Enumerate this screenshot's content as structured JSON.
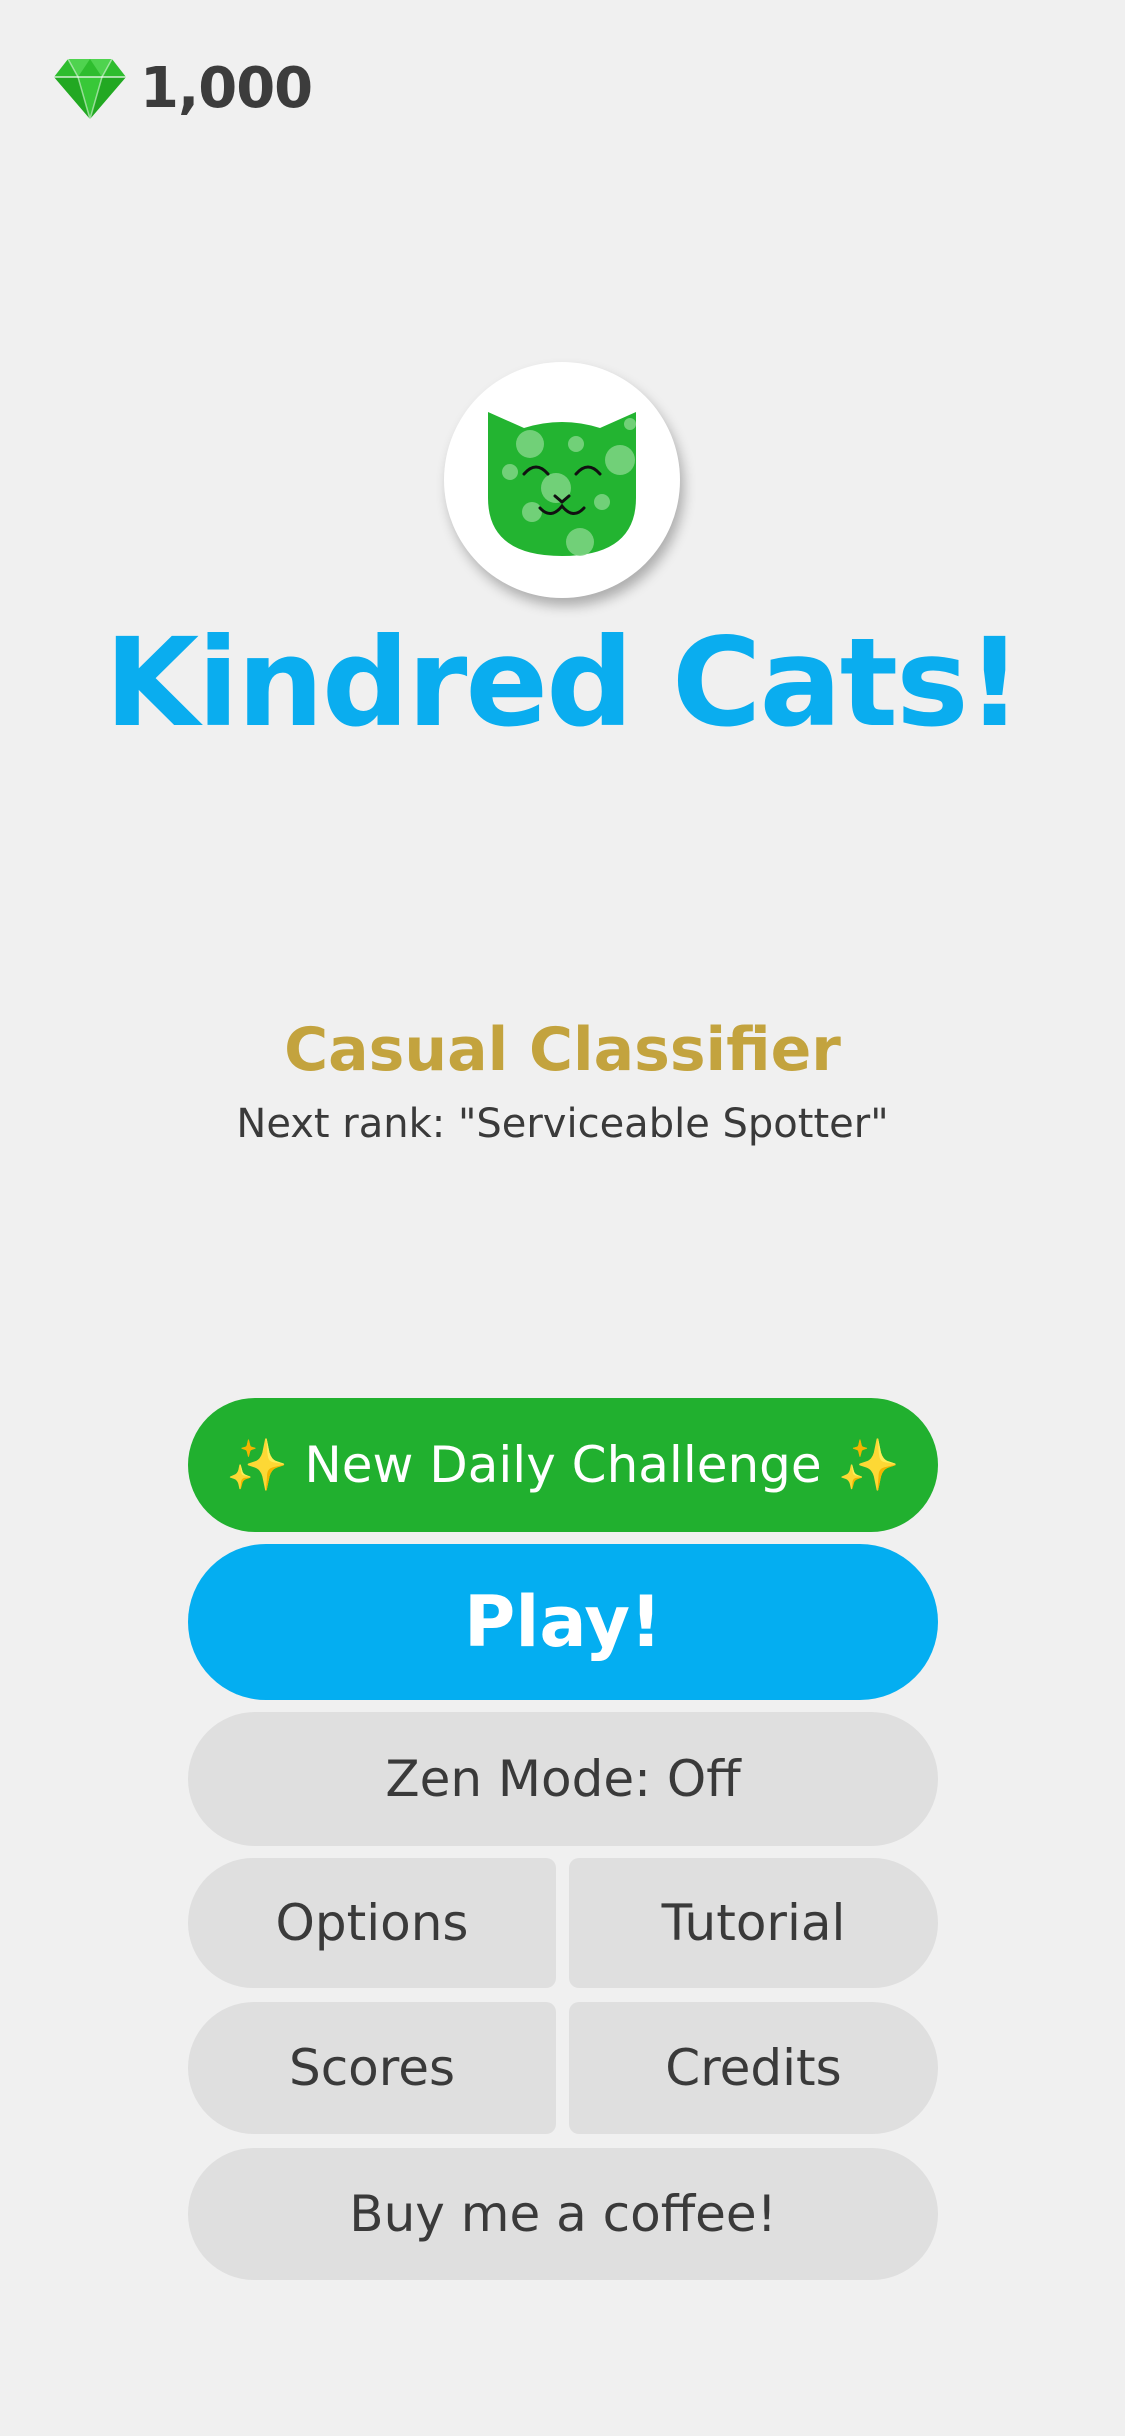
{
  "currency": {
    "icon": "gem-icon",
    "count": "1,000",
    "color": "#2ebd2e"
  },
  "app": {
    "title": "Kindred Cats!",
    "logo_icon": "cat-face-icon",
    "title_color": "#0aadef"
  },
  "rank": {
    "current": "Casual Classifier",
    "next_label": "Next rank: \"Serviceable Spotter\"",
    "color": "#c3a33e"
  },
  "menu": {
    "daily_challenge": "✨ New Daily Challenge ✨",
    "play": "Play!",
    "zen_mode": "Zen Mode: Off",
    "options": "Options",
    "tutorial": "Tutorial",
    "scores": "Scores",
    "credits": "Credits",
    "coffee": "Buy me a coffee!"
  },
  "colors": {
    "background": "#f0f0f0",
    "daily_button": "#21b02f",
    "play_button": "#04aef1",
    "secondary_button": "#dfdfdf"
  }
}
